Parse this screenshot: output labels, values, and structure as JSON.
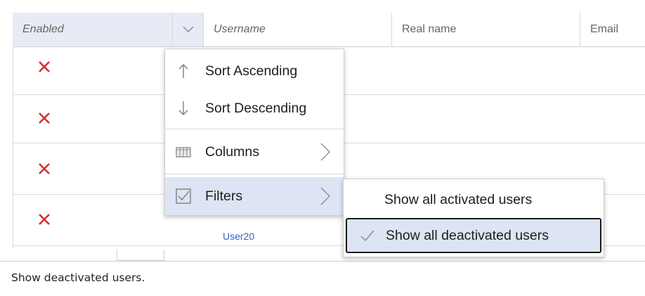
{
  "columns": {
    "enabled": "Enabled",
    "username": "Username",
    "real_name": "Real name",
    "email": "Email"
  },
  "rows": [
    {
      "enabled_icon": "red-x-icon",
      "username": ""
    },
    {
      "enabled_icon": "red-x-icon",
      "username": ""
    },
    {
      "enabled_icon": "red-x-icon",
      "username": ""
    },
    {
      "enabled_icon": "red-x-icon",
      "username": "User20"
    }
  ],
  "column_menu": {
    "sort_asc": "Sort Ascending",
    "sort_desc": "Sort Descending",
    "columns": "Columns",
    "filters": "Filters"
  },
  "filters_submenu": {
    "show_activated": "Show all activated users",
    "show_deactivated": "Show all deactivated users",
    "selected": "Show all deactivated users"
  },
  "status_text": "Show deactivated users.",
  "colors": {
    "accent_highlight": "#dde4f4",
    "header_active": "#e6ebf5",
    "x_red": "#d32f2f",
    "link_blue": "#2c63c9"
  }
}
